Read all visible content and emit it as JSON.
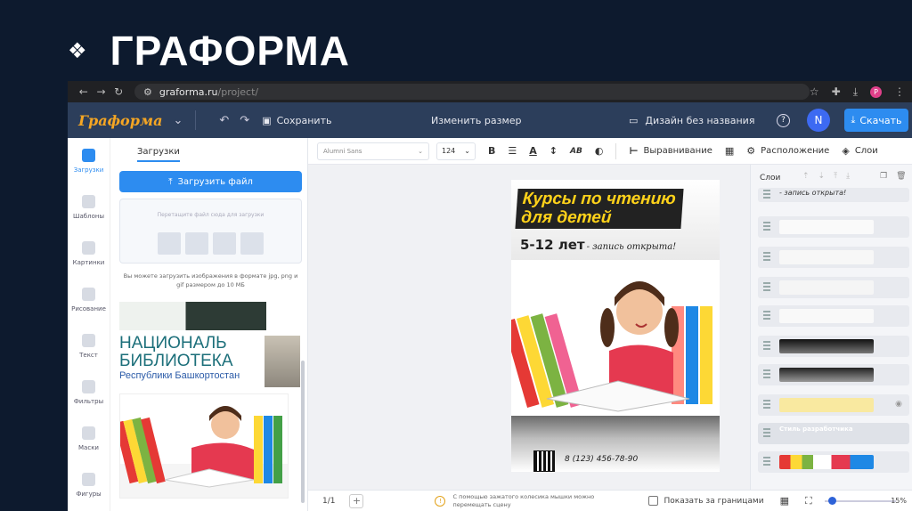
{
  "slide": {
    "bullet": "❖",
    "title": "ГРАФОРМА"
  },
  "browser": {
    "url_main": "graforma.ru",
    "url_path": "/project/",
    "profile_letter": "P"
  },
  "header": {
    "logo": "Граформа",
    "save_label": "Сохранить",
    "resize_label": "Изменить размер",
    "doc_name": "Дизайн без названия",
    "help": "?",
    "avatar": "N",
    "download_label": "Скачать"
  },
  "rail": {
    "items": [
      {
        "label": "Загрузки",
        "active": true
      },
      {
        "label": "Шаблоны"
      },
      {
        "label": "Картинки"
      },
      {
        "label": "Рисование"
      },
      {
        "label": "Текст"
      },
      {
        "label": "Фильтры"
      },
      {
        "label": "Маски"
      },
      {
        "label": "Фигуры"
      }
    ]
  },
  "uploads": {
    "tab": "Загрузки",
    "upload_button": "Загрузить файл",
    "drop_text": "Перетащите файл сюда для загрузки",
    "hint": "Вы можете загрузить изображения в формате jpg, png и gif размером до 10 МБ",
    "library_line1": "НАЦИОНАЛЬ",
    "library_line2": "БИБЛИОТЕКА",
    "library_line3": "Республики Башкортостан"
  },
  "toolbar": {
    "font": "Alumni Sans",
    "size": "124",
    "bold": "B",
    "letter_spacing": "AB",
    "align_label": "Выравнивание",
    "position_label": "Расположение",
    "layers_label": "Слои"
  },
  "poster": {
    "title_line1": "Курсы по чтению",
    "title_line2": "для детей",
    "age": "5-12 лет",
    "enroll": "- запись открыта!",
    "phone": "8 (123) 456-78-90"
  },
  "layers": {
    "title": "Слои",
    "text_layer": "- запись открыта!",
    "style_layer": "Стиль разработчика"
  },
  "bottom": {
    "pages": "1/1",
    "tip": "С помощью зажатого колесика мышки можно перемещать сцену",
    "show_outside": "Показать за границами",
    "zoom": "15%",
    "zoom_fraction": 0.05
  },
  "colors": {
    "accent": "#2d8cf0",
    "header": "#2c3e5b",
    "poster_yellow": "#ffd21a"
  }
}
